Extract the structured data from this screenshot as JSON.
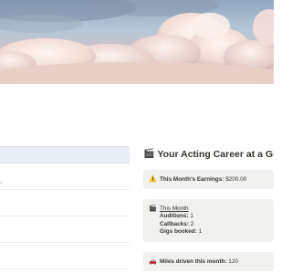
{
  "cover": {
    "description_icon": "clouds-cover"
  },
  "left_table": {
    "fragment_text": ","
  },
  "dashboard": {
    "title_icon": "🎬",
    "title": "Your Acting Career at a Glan",
    "earnings": {
      "icon": "⚠️",
      "label": "This Month's Earnings:",
      "value": "$200.00"
    },
    "month": {
      "icon": "🎬",
      "heading": "This Month",
      "auditions_label": "Auditions:",
      "auditions_value": "1",
      "callbacks_label": "Callbacks:",
      "callbacks_value": "2",
      "gigs_label": "Gigs booked:",
      "gigs_value": "1"
    },
    "miles": {
      "icon": "🚗",
      "label": "Miles driven this month:",
      "value": "120"
    }
  },
  "colors": {
    "card_bg": "#f1f1ef",
    "table_header_bg": "#e8eef4",
    "text": "#37352f"
  }
}
